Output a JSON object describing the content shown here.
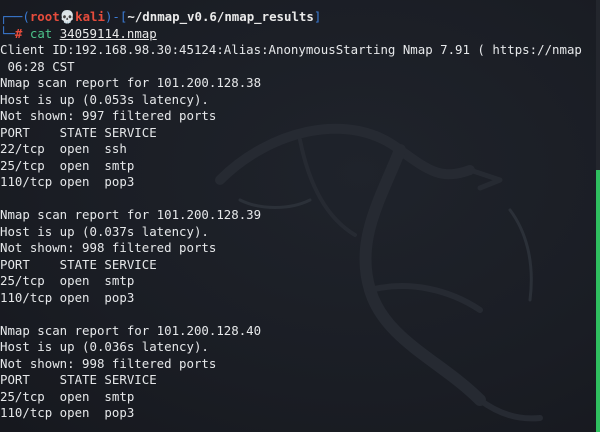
{
  "prompt": {
    "bracket_open": "┌──(",
    "user": "root",
    "skull": "💀",
    "host": "kali",
    "mid": ")-[",
    "path": "~/dnmap_v0.6/nmap_results",
    "bracket_close": "]",
    "corner": "└─",
    "hash": "#",
    "command": "cat",
    "argument": "34059114.nmap"
  },
  "output_lines": [
    "Client ID:192.168.98.30:45124:Alias:AnonymousStarting Nmap 7.91 ( https://nmap",
    " 06:28 CST",
    "Nmap scan report for 101.200.128.38",
    "Host is up (0.053s latency).",
    "Not shown: 997 filtered ports",
    "PORT    STATE SERVICE",
    "22/tcp  open  ssh",
    "25/tcp  open  smtp",
    "110/tcp open  pop3",
    "",
    "Nmap scan report for 101.200.128.39",
    "Host is up (0.037s latency).",
    "Not shown: 998 filtered ports",
    "PORT    STATE SERVICE",
    "25/tcp  open  smtp",
    "110/tcp open  pop3",
    "",
    "Nmap scan report for 101.200.128.40",
    "Host is up (0.036s latency).",
    "Not shown: 998 filtered ports",
    "PORT    STATE SERVICE",
    "25/tcp  open  smtp",
    "110/tcp open  pop3"
  ],
  "colors": {
    "background": "#1a1d24",
    "text": "#e6e8ea",
    "prompt_frame": "#3a7bd5",
    "prompt_user": "#e74c3c",
    "command": "#4cc38a",
    "scroll_thumb": "#2fbf5f"
  },
  "icons": {
    "skull": "skull-icon",
    "background": "kali-dragon-icon"
  }
}
